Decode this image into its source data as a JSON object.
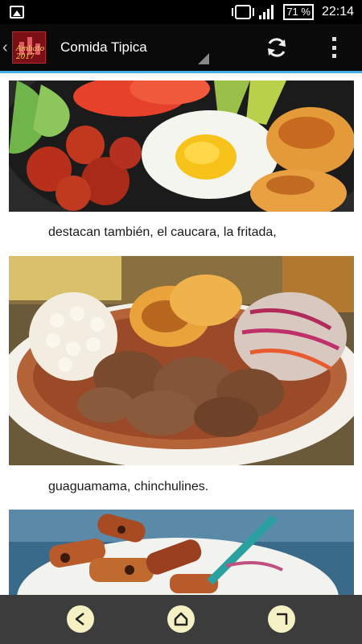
{
  "status_bar": {
    "battery": "71 %",
    "time": "22:14",
    "icons": [
      "image-notification-icon",
      "vibrate-icon",
      "signal-icon",
      "battery-icon"
    ]
  },
  "app_bar": {
    "title": "Comida Tipica",
    "logo_text": "Ambato 2017",
    "accent_color": "#45aee6",
    "icons": [
      "back-chevron-icon",
      "refresh-icon",
      "overflow-menu-icon"
    ]
  },
  "content": {
    "images": [
      {
        "name": "food-image-plate-1",
        "depicts": "chorizo, fried egg, llapingachos, avocado, tomato, lettuce"
      },
      {
        "name": "food-image-plate-2",
        "depicts": "fritada, mote, llapingachos, onion salad"
      },
      {
        "name": "food-image-plate-3",
        "depicts": "grilled chinchulines"
      }
    ],
    "captions": [
      "destacan también, el caucara, la fritada,",
      "guaguamama, chinchulines."
    ]
  },
  "nav_bar": {
    "icons": [
      "back-icon",
      "home-icon",
      "recents-icon"
    ],
    "button_color": "#f6f1c4"
  }
}
